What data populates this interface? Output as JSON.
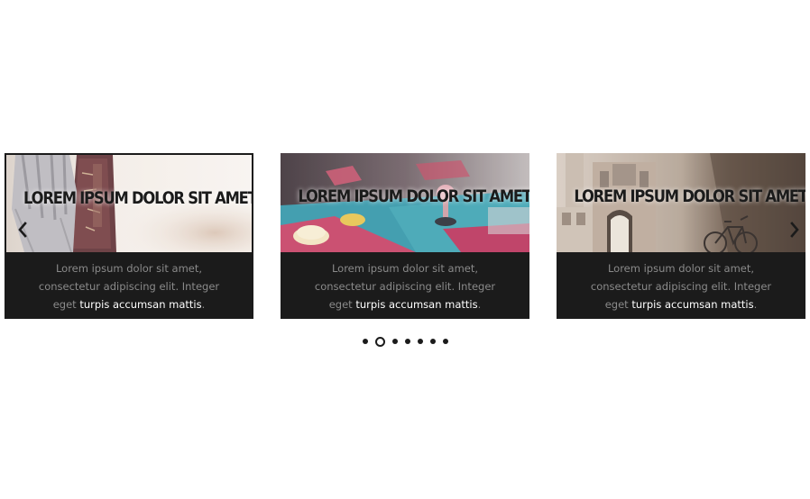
{
  "carousel": {
    "slides": [
      {
        "title": "LOREM IPSUM DOLOR SIT AMET",
        "text_start": "Lorem ipsum dolor sit amet, consectetur adipiscing elit. Integer eget ",
        "text_strong": "turpis accumsan mattis",
        "text_end": ".",
        "image": "hand-on-book-photo"
      },
      {
        "title": "LOREM IPSUM DOLOR SIT AMET",
        "text_start": "Lorem ipsum dolor sit amet, consectetur adipiscing elit. Integer eget ",
        "text_strong": "turpis accumsan mattis",
        "text_end": ".",
        "image": "arcade-controls-photo"
      },
      {
        "title": "LOREM IPSUM DOLOR SIT AMET",
        "text_start": "Lorem ipsum dolor sit amet, consectetur adipiscing elit. Integer eget ",
        "text_strong": "turpis accumsan mattis",
        "text_end": ".",
        "image": "building-bicycle-photo"
      }
    ],
    "prev_icon": "chevron-left-icon",
    "next_icon": "chevron-right-icon",
    "dots_count": 7,
    "active_dot": 1,
    "colors": {
      "dark": "#1b1b1b",
      "body_text": "#8a8a8a",
      "highlight_text": "#ffffff"
    }
  }
}
